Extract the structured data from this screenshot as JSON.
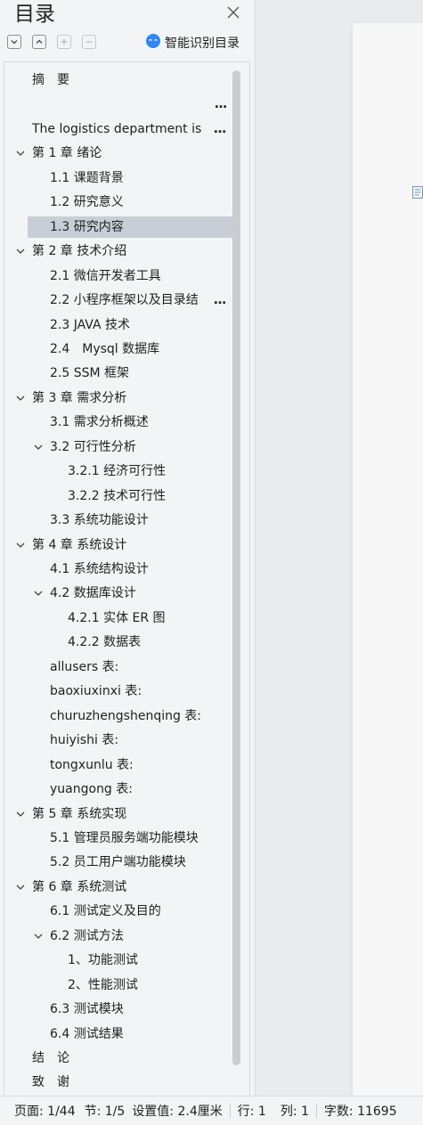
{
  "panel": {
    "title": "目录",
    "smart_label": "智能识别目录"
  },
  "toc": [
    {
      "label": "摘　要",
      "level": 0,
      "chev": false
    },
    {
      "label": "…",
      "level": 0,
      "chev": false,
      "dots_only": true
    },
    {
      "label": "The logistics department is",
      "level": 0,
      "chev": false,
      "more": true
    },
    {
      "label": "第 1 章  绪论",
      "level": 0,
      "chev": true
    },
    {
      "label": "1.1 课题背景",
      "level": 1,
      "chev": false
    },
    {
      "label": "1.2 研究意义",
      "level": 1,
      "chev": false
    },
    {
      "label": "1.3 研究内容",
      "level": 1,
      "chev": false,
      "selected": true
    },
    {
      "label": "第 2 章  技术介绍",
      "level": 0,
      "chev": true
    },
    {
      "label": "2.1 微信开发者工具",
      "level": 1,
      "chev": false
    },
    {
      "label": "2.2 小程序框架以及目录结",
      "level": 1,
      "chev": false,
      "more": true
    },
    {
      "label": "2.3 JAVA 技术",
      "level": 1,
      "chev": false
    },
    {
      "label": "2.4　Mysql 数据库",
      "level": 1,
      "chev": false
    },
    {
      "label": "2.5 SSM 框架",
      "level": 1,
      "chev": false
    },
    {
      "label": "第 3 章  需求分析",
      "level": 0,
      "chev": true
    },
    {
      "label": "3.1 需求分析概述",
      "level": 1,
      "chev": false
    },
    {
      "label": "3.2 可行性分析",
      "level": 1,
      "chev": true
    },
    {
      "label": "3.2.1 经济可行性",
      "level": 2,
      "chev": false
    },
    {
      "label": "3.2.2 技术可行性",
      "level": 2,
      "chev": false
    },
    {
      "label": "3.3 系统功能设计",
      "level": 1,
      "chev": false
    },
    {
      "label": "第 4 章  系统设计",
      "level": 0,
      "chev": true
    },
    {
      "label": "4.1 系统结构设计",
      "level": 1,
      "chev": false
    },
    {
      "label": "4.2 数据库设计",
      "level": 1,
      "chev": true
    },
    {
      "label": "4.2.1 实体 ER 图",
      "level": 2,
      "chev": false
    },
    {
      "label": "4.2.2 数据表",
      "level": 2,
      "chev": false
    },
    {
      "label": "allusers 表:",
      "level": 1,
      "chev": false
    },
    {
      "label": "baoxiuxinxi 表:",
      "level": 1,
      "chev": false
    },
    {
      "label": "churuzhengshenqing 表:",
      "level": 1,
      "chev": false
    },
    {
      "label": "huiyishi 表:",
      "level": 1,
      "chev": false
    },
    {
      "label": "tongxunlu 表:",
      "level": 1,
      "chev": false
    },
    {
      "label": "yuangong 表:",
      "level": 1,
      "chev": false
    },
    {
      "label": "第 5 章  系统实现",
      "level": 0,
      "chev": true
    },
    {
      "label": "5.1 管理员服务端功能模块",
      "level": 1,
      "chev": false
    },
    {
      "label": "5.2 员工用户端功能模块",
      "level": 1,
      "chev": false
    },
    {
      "label": "第 6 章  系统测试",
      "level": 0,
      "chev": true
    },
    {
      "label": "6.1 测试定义及目的",
      "level": 1,
      "chev": false
    },
    {
      "label": "6.2 测试方法",
      "level": 1,
      "chev": true
    },
    {
      "label": "1、功能测试",
      "level": 2,
      "chev": false
    },
    {
      "label": "2、性能测试",
      "level": 2,
      "chev": false
    },
    {
      "label": "6.3 测试模块",
      "level": 1,
      "chev": false
    },
    {
      "label": "6.4 测试结果",
      "level": 1,
      "chev": false
    },
    {
      "label": "结　论",
      "level": 0,
      "chev": false
    },
    {
      "label": "致　谢",
      "level": 0,
      "chev": false
    }
  ],
  "status": {
    "page": "页面: 1/44",
    "section": "节: 1/5",
    "setting": "设置值: 2.4厘米",
    "line": "行: 1",
    "column": "列: 1",
    "words": "字数: 11695"
  }
}
